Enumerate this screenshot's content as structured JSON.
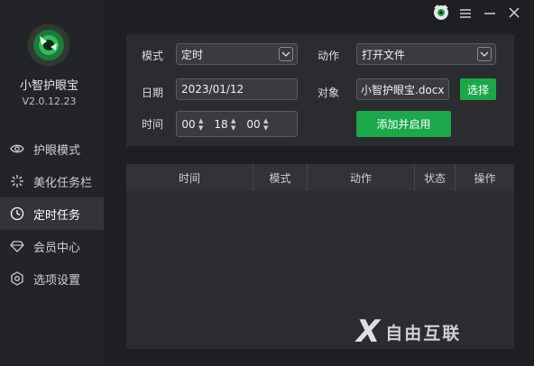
{
  "app": {
    "name": "小智护眼宝",
    "version": "V2.0.12.23"
  },
  "nav": {
    "items": [
      {
        "label": "护眼模式",
        "icon": "eye-icon"
      },
      {
        "label": "美化任务栏",
        "icon": "sparkle-icon"
      },
      {
        "label": "定时任务",
        "icon": "clock-icon",
        "active": true
      },
      {
        "label": "会员中心",
        "icon": "diamond-icon"
      },
      {
        "label": "选项设置",
        "icon": "gear-icon"
      }
    ]
  },
  "form": {
    "mode_label": "模式",
    "mode_value": "定时",
    "action_label": "动作",
    "action_value": "打开文件",
    "date_label": "日期",
    "date_value": "2023/01/12",
    "target_label": "对象",
    "target_value": "小智护眼宝.docx",
    "choose_label": "选择",
    "time_label": "时间",
    "time_h": "00",
    "time_m": "18",
    "time_s": "00",
    "add_label": "添加并启用"
  },
  "table": {
    "columns": [
      "时间",
      "模式",
      "动作",
      "状态",
      "操作"
    ],
    "rows": []
  },
  "watermark": {
    "mark": "X",
    "text": "自由互联"
  },
  "colors": {
    "accent": "#1aa84a",
    "bg": "#1e1f22",
    "panel": "#2b2c2f"
  }
}
